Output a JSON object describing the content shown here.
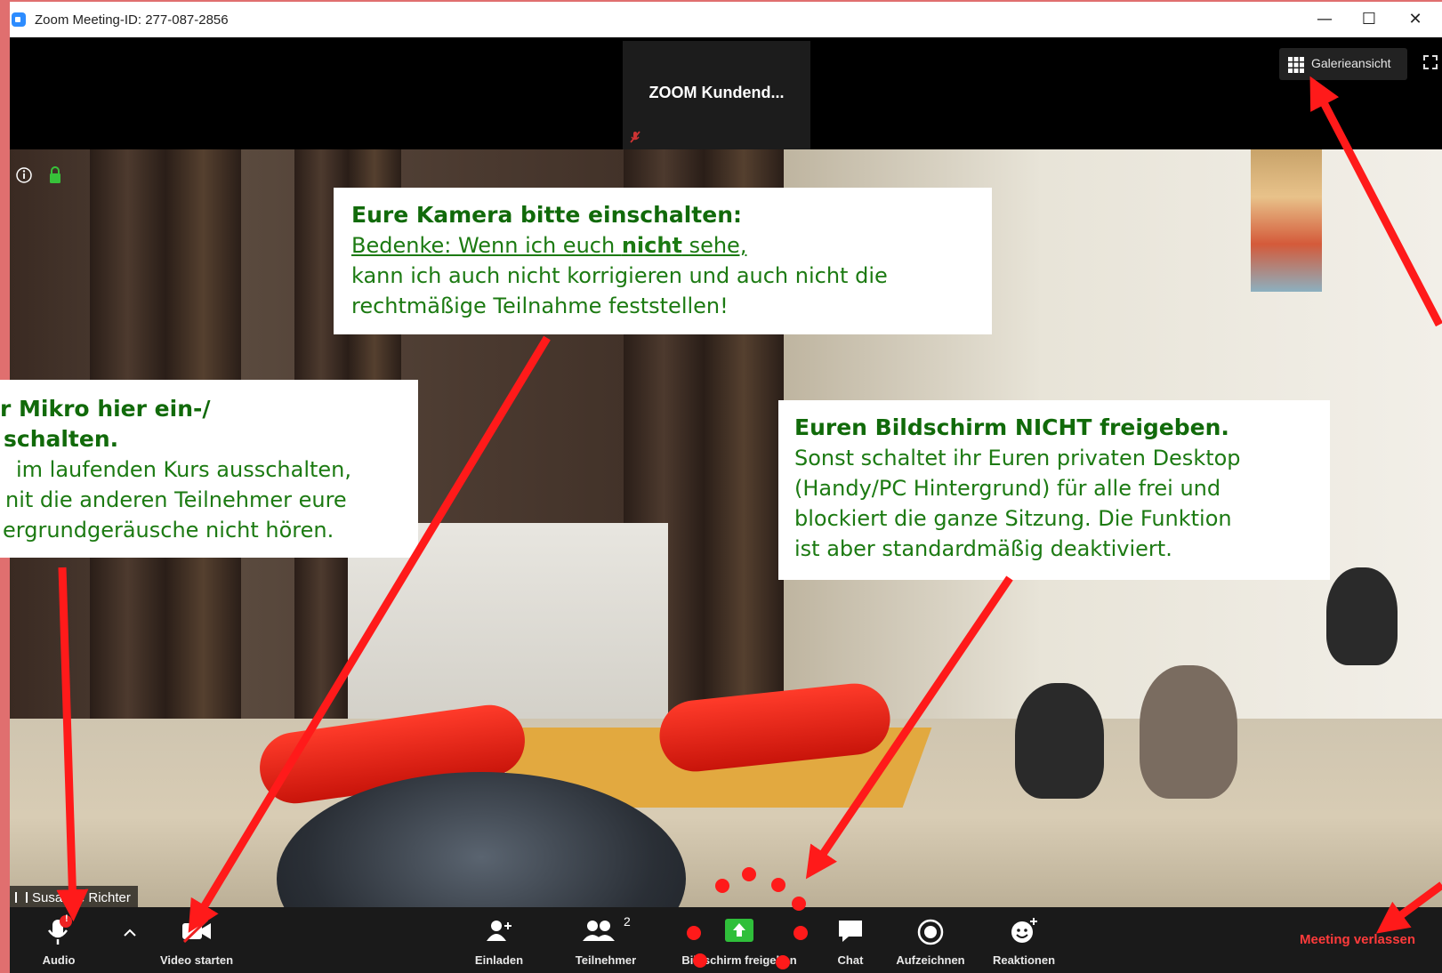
{
  "window": {
    "title": "Zoom Meeting-ID: 277-087-2856",
    "minimize": "—",
    "maximize": "☐",
    "close": "✕"
  },
  "participant_tile": {
    "name": "ZOOM  Kundend..."
  },
  "view_controls": {
    "gallery_label": "Galerieansicht"
  },
  "speaker": {
    "name": "Susanne Richter"
  },
  "toolbar": {
    "audio": "Audio",
    "video": "Video starten",
    "invite": "Einladen",
    "participants": "Teilnehmer",
    "participants_count": "2",
    "share": "Bildschirm freigeben",
    "chat": "Chat",
    "record": "Aufzeichnen",
    "reactions": "Reaktionen",
    "leave": "Meeting verlassen",
    "audio_badge": "!"
  },
  "annotations": {
    "camera": {
      "heading": "Eure Kamera bitte einschalten:",
      "line1_prefix": "Bedenke: Wenn ich euch ",
      "line1_bold": "nicht",
      "line1_suffix": " sehe,",
      "line2": "kann ich auch nicht korrigieren und auch nicht die",
      "line3": "rechtmäßige Teilnahme feststellen!"
    },
    "mic": {
      "heading1": "r Mikro hier ein-/",
      "heading2": "schalten.",
      "line1": "im laufenden Kurs ausschalten,",
      "line2": "nit die anderen Teilnehmer eure",
      "line3": "ergrundgeräusche nicht hören."
    },
    "screen": {
      "heading": "Euren Bildschirm NICHT freigeben.",
      "line1": "Sonst schaltet ihr Euren privaten Desktop",
      "line2": "(Handy/PC Hintergrund) für alle frei und",
      "line3": "blockiert die ganze Sitzung. Die Funktion",
      "line4": "ist aber standardmäßig deaktiviert."
    }
  },
  "colors": {
    "annotation_green": "#116a0a",
    "arrow_red": "#ff1a1a",
    "leave_red": "#ff3b3b",
    "share_green": "#2fbf3a"
  }
}
